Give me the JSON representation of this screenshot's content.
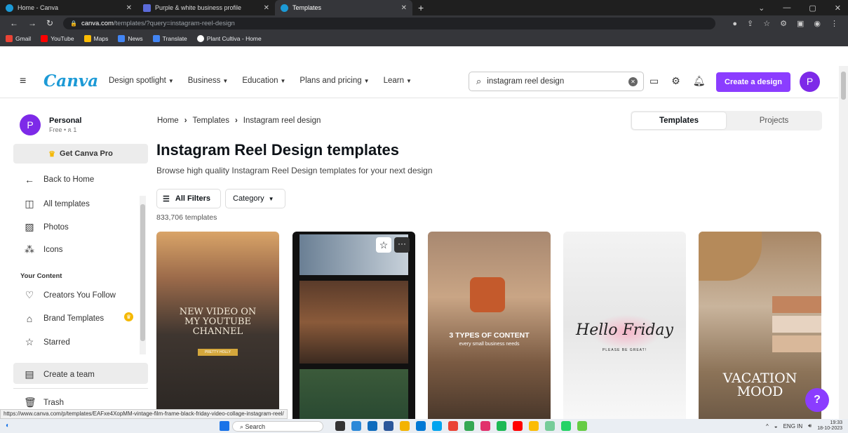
{
  "browser": {
    "tabs": [
      {
        "label": "Home - Canva",
        "color": "#1c9ad6"
      },
      {
        "label": "Purple & white business profile",
        "color": "#5b6bd9"
      },
      {
        "label": "Templates",
        "color": "#1c9ad6"
      }
    ],
    "url_host": "canva.com",
    "url_path": "/templates/?query=instagram-reel-design",
    "bookmarks": [
      {
        "label": "Gmail",
        "color": "#ea4335"
      },
      {
        "label": "YouTube",
        "color": "#ff0000"
      },
      {
        "label": "Maps",
        "color": "#fbbc04"
      },
      {
        "label": "News",
        "color": "#4285f4"
      },
      {
        "label": "Translate",
        "color": "#4285f4"
      },
      {
        "label": "Plant Cultiva - Home",
        "color": "#ffffff"
      }
    ]
  },
  "header": {
    "logo": "Canva",
    "nav": [
      "Design spotlight",
      "Business",
      "Education",
      "Plans and pricing",
      "Learn"
    ],
    "search_value": "instagram reel design",
    "create_label": "Create a design",
    "avatar_letter": "P",
    "accent": "#8b3dff"
  },
  "sidebar": {
    "account_name": "Personal",
    "account_sub": "Free • ጸ 1",
    "avatar_letter": "P",
    "pro_label": "Get Canva Pro",
    "back_label": "Back to Home",
    "items": [
      "All templates",
      "Photos",
      "Icons"
    ],
    "section_heading": "Your Content",
    "content_items": [
      "Creators You Follow",
      "Brand Templates",
      "Starred"
    ],
    "team_label": "Create a team",
    "trash_label": "Trash"
  },
  "main": {
    "breadcrumb": [
      "Home",
      "Templates",
      "Instagram reel design"
    ],
    "toggle": [
      "Templates",
      "Projects"
    ],
    "title": "Instagram Reel Design templates",
    "subtitle": "Browse high quality Instagram Reel Design templates for your next design",
    "filters_label": "All Filters",
    "category_label": "Category",
    "count": "833,706 templates",
    "cards": [
      {
        "text": "NEW VIDEO ON MY YOUTUBE CHANNEL",
        "sub": "PRETTY HOLLY"
      },
      {
        "text": "",
        "sub": ""
      },
      {
        "text": "3 TYPES OF CONTENT",
        "sub": "every small business needs"
      },
      {
        "text": "Hello Friday",
        "sub": "PLEASE BE GREAT!"
      },
      {
        "text": "VACATION MOOD",
        "sub": ""
      }
    ]
  },
  "status_url": "https://www.canva.com/p/templates/EAFxe4XopMM-vintage-film-frame-black-friday-video-collage-instagram-reel/",
  "help_label": "?",
  "taskbar": {
    "search_label": "Search",
    "lang": "ENG IN",
    "time": "19:33",
    "date": "18-10-2023"
  }
}
